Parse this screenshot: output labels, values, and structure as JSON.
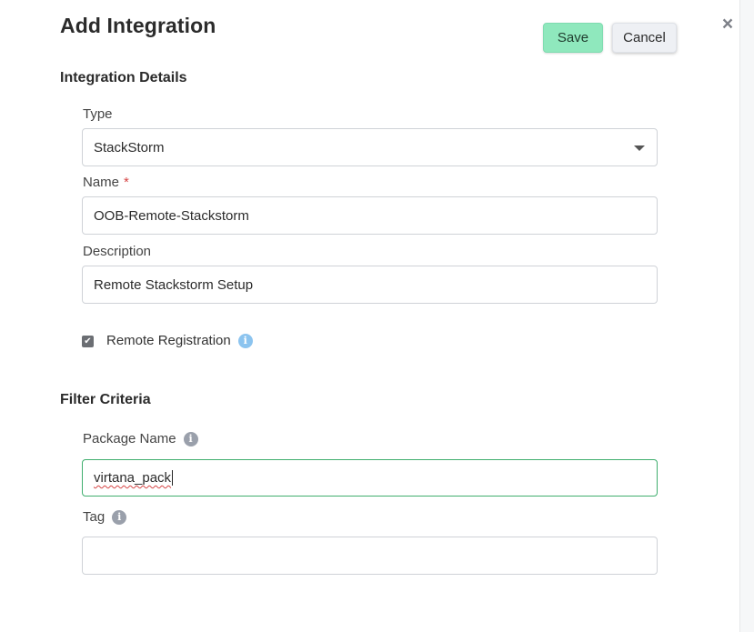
{
  "dialog": {
    "title": "Add Integration",
    "save_label": "Save",
    "cancel_label": "Cancel",
    "close_glyph": "×"
  },
  "integration_details": {
    "section_title": "Integration Details",
    "type": {
      "label": "Type",
      "value": "StackStorm"
    },
    "name": {
      "label": "Name",
      "required_mark": "*",
      "value": "OOB-Remote-Stackstorm"
    },
    "description": {
      "label": "Description",
      "value": "Remote Stackstorm Setup"
    },
    "remote_registration": {
      "label": "Remote Registration",
      "checked": true,
      "check_glyph": "✔"
    }
  },
  "filter_criteria": {
    "section_title": "Filter Criteria",
    "package_name": {
      "label": "Package Name",
      "value": "virtana_pack"
    },
    "tag": {
      "label": "Tag",
      "value": ""
    }
  },
  "icons": {
    "info_glyph": "i",
    "info_gray_color": "#9aa0ab",
    "info_blue_color": "#8cc4ef",
    "save_color": "#8fe8bd",
    "focus_border_color": "#3fae6e",
    "required_color": "#d64545"
  }
}
